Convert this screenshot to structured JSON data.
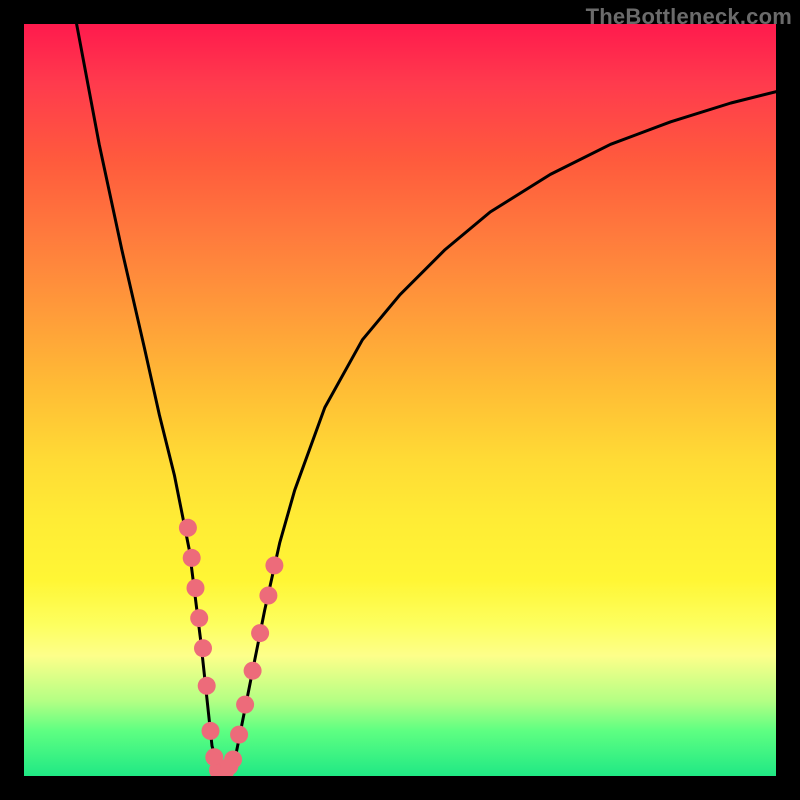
{
  "watermark": "TheBottleneck.com",
  "chart_data": {
    "type": "line",
    "title": "",
    "xlabel": "",
    "ylabel": "",
    "xlim": [
      0,
      100
    ],
    "ylim": [
      0,
      100
    ],
    "series": [
      {
        "name": "curve",
        "x": [
          7,
          10,
          13,
          16,
          18,
          20,
          22,
          23.5,
          25,
          26,
          27,
          28,
          30,
          32,
          34,
          36,
          40,
          45,
          50,
          56,
          62,
          70,
          78,
          86,
          94,
          100
        ],
        "y": [
          100,
          84,
          70,
          57,
          48,
          40,
          30,
          18,
          4,
          0.5,
          0.5,
          2,
          12,
          22,
          31,
          38,
          49,
          58,
          64,
          70,
          75,
          80,
          84,
          87,
          89.5,
          91
        ]
      }
    ],
    "markers": {
      "name": "highlight-beads",
      "color": "#ed6b7a",
      "points": [
        {
          "x": 21.8,
          "y": 33
        },
        {
          "x": 22.3,
          "y": 29
        },
        {
          "x": 22.8,
          "y": 25
        },
        {
          "x": 23.3,
          "y": 21
        },
        {
          "x": 23.8,
          "y": 17
        },
        {
          "x": 24.3,
          "y": 12
        },
        {
          "x": 24.8,
          "y": 6
        },
        {
          "x": 25.3,
          "y": 2.5
        },
        {
          "x": 25.8,
          "y": 0.8
        },
        {
          "x": 26.3,
          "y": 0.5
        },
        {
          "x": 26.8,
          "y": 0.7
        },
        {
          "x": 27.3,
          "y": 1.3
        },
        {
          "x": 27.8,
          "y": 2.2
        },
        {
          "x": 28.6,
          "y": 5.5
        },
        {
          "x": 29.4,
          "y": 9.5
        },
        {
          "x": 30.4,
          "y": 14
        },
        {
          "x": 31.4,
          "y": 19
        },
        {
          "x": 32.5,
          "y": 24
        },
        {
          "x": 33.3,
          "y": 28
        }
      ]
    },
    "gradient_bands": [
      {
        "stop": 0,
        "color": "#ff1a4d"
      },
      {
        "stop": 60,
        "color": "#ffdb35"
      },
      {
        "stop": 80,
        "color": "#fdff60"
      },
      {
        "stop": 100,
        "color": "#20e884"
      }
    ]
  }
}
